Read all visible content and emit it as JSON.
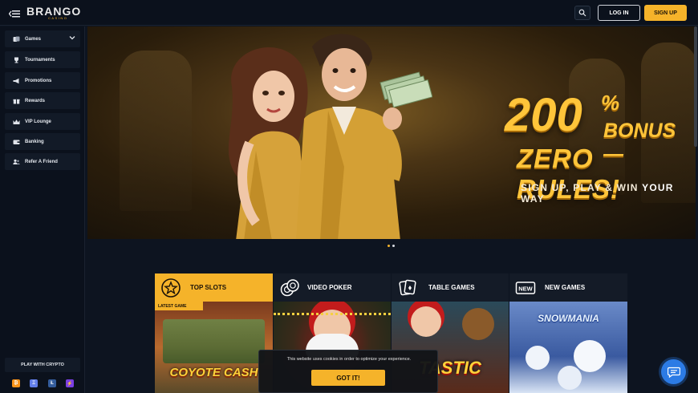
{
  "header": {
    "logo_text_main": "BRANGO",
    "logo_text_sub": "CASINO",
    "login_label": "LOG IN",
    "signup_label": "SIGN UP",
    "icons": [
      "hamburger-menu-icon",
      "search-icon"
    ]
  },
  "sidebar": {
    "items": [
      {
        "label": "Games",
        "icon": "cards-icon",
        "expandable": true
      },
      {
        "label": "Tournaments",
        "icon": "trophy-icon"
      },
      {
        "label": "Promotions",
        "icon": "megaphone-icon"
      },
      {
        "label": "Rewards",
        "icon": "gift-icon"
      },
      {
        "label": "VIP Lounge",
        "icon": "crown-icon"
      },
      {
        "label": "Banking",
        "icon": "wallet-icon"
      },
      {
        "label": "Refer A Friend",
        "icon": "users-icon"
      }
    ],
    "crypto_title": "PLAY WITH CRYPTO",
    "crypto_icons": [
      {
        "name": "bitcoin-icon",
        "glyph": "₿",
        "color": "#f7931a"
      },
      {
        "name": "ethereum-icon",
        "glyph": "Ξ",
        "color": "#627eea"
      },
      {
        "name": "litecoin-icon",
        "glyph": "Ł",
        "color": "#345d9d"
      },
      {
        "name": "lightning-icon",
        "glyph": "⚡",
        "color": "#7b3fe4"
      }
    ]
  },
  "banner": {
    "headline_amount": "200",
    "headline_percent": "%",
    "headline_bonus": "BONUS —",
    "headline_rules": "ZERO RULES!",
    "subline_pre": "SIGN UP, PLAY & WIN ",
    "subline_emph": "YOUR",
    "subline_post": " WAY",
    "carousel_dots": 2,
    "active_dot": 0
  },
  "categories": [
    {
      "label": "TOP SLOTS",
      "icon": "star-icon",
      "active": true
    },
    {
      "label": "VIDEO POKER",
      "icon": "poker-chips-icon",
      "active": false
    },
    {
      "label": "TABLE GAMES",
      "icon": "playing-cards-icon",
      "active": false
    },
    {
      "label": "NEW GAMES",
      "icon": "new-badge-icon",
      "active": false
    }
  ],
  "thumbnails": [
    {
      "badge": "LATEST GAME",
      "title": "COYOTE CASH"
    },
    {
      "title": ""
    },
    {
      "title": "TASTIC"
    },
    {
      "title": "SNOWMANIA"
    }
  ],
  "cookie": {
    "text": "This website uses cookies in order to optimize your experience.",
    "button": "GOT IT!"
  },
  "colors": {
    "accent": "#f5b32a",
    "background": "#0d1420",
    "sidebar": "#0b111c",
    "chat": "#2c7be5"
  }
}
